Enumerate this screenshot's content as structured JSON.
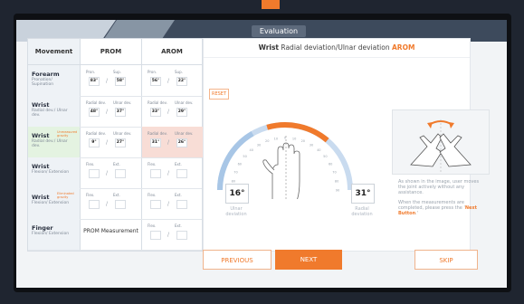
{
  "header": {
    "title": "Evaluation"
  },
  "table": {
    "headers": {
      "movement": "Movement",
      "prom": "PROM",
      "arom": "AROM"
    },
    "rows": [
      {
        "name": "Forearm",
        "sub": "Pronation/ Supination",
        "tag": "",
        "prom": {
          "l1": "Pron.",
          "l2": "Sup.",
          "v1": "83°",
          "v2": "58°"
        },
        "arom": {
          "l1": "Pron.",
          "l2": "Sup.",
          "v1": "56°",
          "v2": "22°"
        }
      },
      {
        "name": "Wrist",
        "sub": "Radial dev./ Ulnar dev.",
        "tag": "",
        "prom": {
          "l1": "Radial dev.",
          "l2": "Ulnar dev.",
          "v1": "48°",
          "v2": "37°"
        },
        "arom": {
          "l1": "Radial dev.",
          "l2": "Ulnar dev.",
          "v1": "33°",
          "v2": "29°"
        }
      },
      {
        "name": "Wrist",
        "sub": "Radial dev./ Ulnar dev.",
        "tag": "Unmeasured gravity",
        "prom": {
          "l1": "Radial dev.",
          "l2": "Ulnar dev.",
          "v1": "9°",
          "v2": "27°"
        },
        "arom": {
          "l1": "Radial dev.",
          "l2": "Ulnar dev.",
          "v1": "31°",
          "v2": "26°"
        }
      },
      {
        "name": "Wrist",
        "sub": "Flexion/ Extension",
        "tag": "",
        "prom": {
          "l1": "Flex.",
          "l2": "Ext.",
          "v1": "",
          "v2": ""
        },
        "arom": {
          "l1": "Flex.",
          "l2": "Ext.",
          "v1": "",
          "v2": ""
        }
      },
      {
        "name": "Wrist",
        "sub": "Flexion/ Extension",
        "tag": "Eliminated gravity",
        "prom": {
          "l1": "Flex.",
          "l2": "Ext.",
          "v1": "",
          "v2": ""
        },
        "arom": {
          "l1": "Flex.",
          "l2": "Ext.",
          "v1": "",
          "v2": ""
        }
      },
      {
        "name": "Finger",
        "sub": "Flexion/ Extension",
        "tag": "",
        "prom_text": "PROM Measurement",
        "arom": {
          "l1": "Flex.",
          "l2": "Ext.",
          "v1": "",
          "v2": ""
        }
      }
    ]
  },
  "panel": {
    "title_bold": "Wrist",
    "title_rest": " Radial deviation/Ulnar deviation ",
    "title_mode": "AROM",
    "reset": "RESET",
    "left_value": "16°",
    "left_label": "Ulnar deviation",
    "right_value": "31°",
    "right_label": "Radial deviation",
    "description_1": "As shown in the image, user moves the joint actively without any assistance.",
    "description_2a": "When the measurements are completed, please press the '",
    "description_2b": "Next Button",
    "description_2c": ".'",
    "gauge_ticks": [
      "90",
      "80",
      "70",
      "60",
      "50",
      "40",
      "30",
      "20",
      "10",
      "0",
      "10",
      "20",
      "30",
      "40",
      "50",
      "60",
      "70",
      "80",
      "90"
    ]
  },
  "buttons": {
    "previous": "PREVIOUS",
    "next": "NEXT",
    "skip": "SKIP"
  },
  "colors": {
    "accent": "#f07a2c",
    "topbar": "#3d4a5c",
    "gauge_blue": "#a8c6e6"
  }
}
